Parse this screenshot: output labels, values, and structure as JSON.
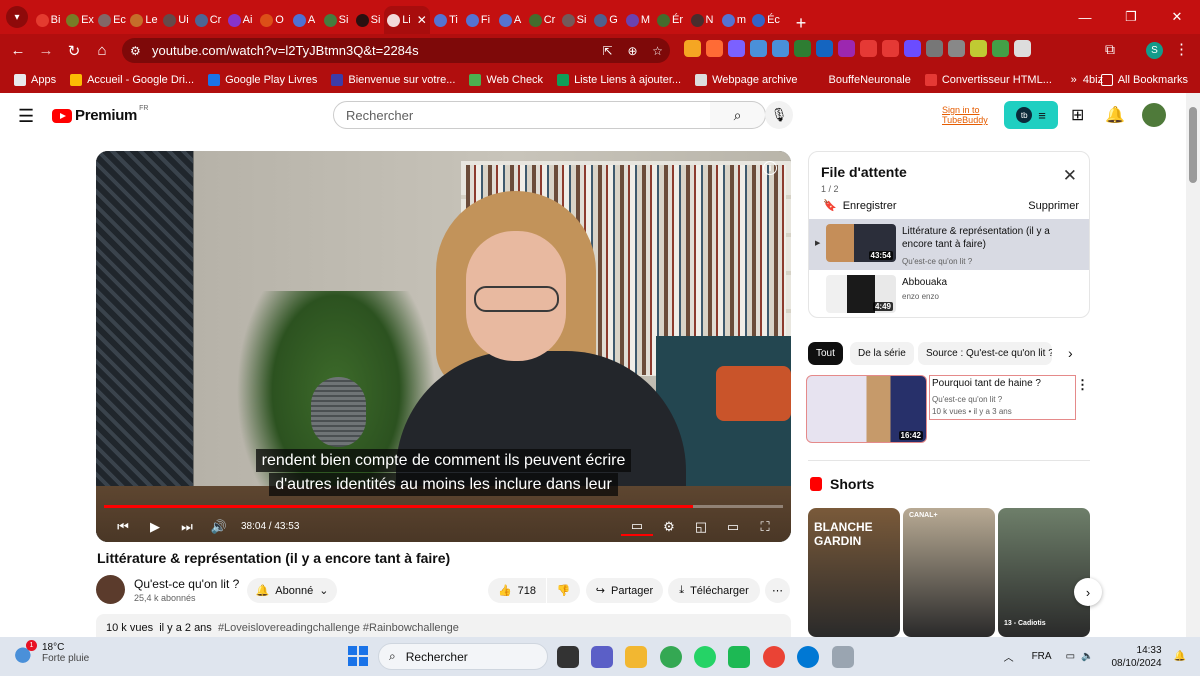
{
  "browser": {
    "tabs": [
      {
        "label": "Bi",
        "color": "#ea4335"
      },
      {
        "label": "Ex",
        "color": "#6a8f2a"
      },
      {
        "label": "Ec",
        "color": "#777777"
      },
      {
        "label": "Le",
        "color": "#c57f2f"
      },
      {
        "label": "Ui",
        "color": "#555555"
      },
      {
        "label": "Cr",
        "color": "#3776ab"
      },
      {
        "label": "Ai",
        "color": "#7c3aed"
      },
      {
        "label": "O",
        "color": "#e05a1a"
      },
      {
        "label": "A",
        "color": "#3b82f6"
      },
      {
        "label": "Si",
        "color": "#2f8f46"
      },
      {
        "label": "Si",
        "color": "#111111"
      }
    ],
    "active_tab": {
      "label": "Li",
      "close": "✕"
    },
    "tabs_after": [
      {
        "label": "Ti",
        "color": "#4285f4"
      },
      {
        "label": "Fi",
        "color": "#4285f4"
      },
      {
        "label": "A",
        "color": "#4285f4"
      },
      {
        "label": "Cr",
        "color": "#2e7d32"
      },
      {
        "label": "Si",
        "color": "#666666"
      },
      {
        "label": "G",
        "color": "#3a6ea5"
      },
      {
        "label": "M",
        "color": "#5b4bcc"
      },
      {
        "label": "Ér",
        "color": "#2e7d32"
      },
      {
        "label": "N",
        "color": "#333333"
      },
      {
        "label": "m",
        "color": "#4285f4"
      },
      {
        "label": "Éc",
        "color": "#1a73e8"
      }
    ],
    "new_tab": "+",
    "url": "youtube.com/watch?v=l2TyJBtmn3Q&t=2284s",
    "profile_initial": "S",
    "bookmarks": [
      {
        "label": "Apps",
        "color": "#e8eaed"
      },
      {
        "label": "Accueil - Google Dri...",
        "color": "#fbbc04"
      },
      {
        "label": "Google Play Livres",
        "color": "#1a73e8"
      },
      {
        "label": "Bienvenue sur votre...",
        "color": "#3c3ca8"
      },
      {
        "label": "Web Check",
        "color": "#4caf50"
      },
      {
        "label": "Liste Liens à ajouter...",
        "color": "#0f9d58"
      },
      {
        "label": "Webpage archive",
        "color": "#dddddd"
      },
      {
        "label": "BouffeNeuronale",
        "color": "#b10e0e"
      },
      {
        "label": "Convertisseur HTML...",
        "color": "#e53935"
      },
      {
        "label": "4biz",
        "color": "#b10e0e"
      }
    ],
    "all_bookmarks": "All Bookmarks",
    "extension_colors": [
      "#f5a623",
      "#ff6b35",
      "#7b61ff",
      "#4a90d9",
      "#4a90d9",
      "#2e7d32",
      "#1565c0",
      "#9c27b0",
      "#e53935",
      "#e53935",
      "#6b4cff",
      "#777777",
      "#888888",
      "#c0ca33",
      "#43a047",
      "#dddddd"
    ]
  },
  "youtube": {
    "logo_text": "Premium",
    "logo_region": "FR",
    "search_placeholder": "Rechercher",
    "tubebuddy_line1": "Sign in to",
    "tubebuddy_line2": "TubeBuddy",
    "tubebuddy_badge": "tb",
    "player": {
      "subtitle_line1": "rendent bien compte de comment ils peuvent écrire",
      "subtitle_line2": "d'autres identités au moins les inclure dans leur",
      "time": "38:04 / 43:53",
      "progress": 0.867
    },
    "video_title": "Littérature & représentation (il y a encore tant à faire)",
    "channel_name": "Qu'est-ce qu'on lit ?",
    "channel_subs": "25,4 k abonnés",
    "subscribed_label": "Abonné",
    "likes": "718",
    "share_label": "Partager",
    "download_label": "Télécharger",
    "description": {
      "views": "10 k vues",
      "date": "il y a 2 ans",
      "tags": "#Loveislovereadingchallenge #Rainbowchallenge"
    },
    "queue": {
      "title": "File d'attente",
      "count": "1 / 2",
      "save": "Enregistrer",
      "delete": "Supprimer",
      "items": [
        {
          "title": "Littérature & représentation (il y a encore tant à faire)",
          "channel": "Qu'est-ce qu'on lit ?",
          "duration": "43:54",
          "playing": true
        },
        {
          "title": "Abbouaka",
          "channel": "enzo enzo",
          "duration": "4:49",
          "playing": false
        }
      ]
    },
    "chips": [
      "Tout",
      "De la série",
      "Source : Qu'est-ce qu'on lit ?"
    ],
    "recommendation": {
      "title": "Pourquoi tant de haine ?",
      "channel": "Qu'est-ce qu'on lit ?",
      "meta": "10 k vues • il y a 3 ans",
      "duration": "16:42"
    },
    "shorts_title": "Shorts",
    "shorts": [
      {
        "overlay": "BLANCHE GARDIN",
        "color": "#7a5a3a"
      },
      {
        "overlay": "CANAL+",
        "color": "#b8aa94"
      },
      {
        "overlay": "13 - Cadiotis",
        "color": "#6e7f6a"
      }
    ]
  },
  "taskbar": {
    "temperature": "18°C",
    "weather": "Forte pluie",
    "weather_badge": "1",
    "search_label": "Rechercher",
    "language": "FRA",
    "time": "14:33",
    "date": "08/10/2024"
  }
}
